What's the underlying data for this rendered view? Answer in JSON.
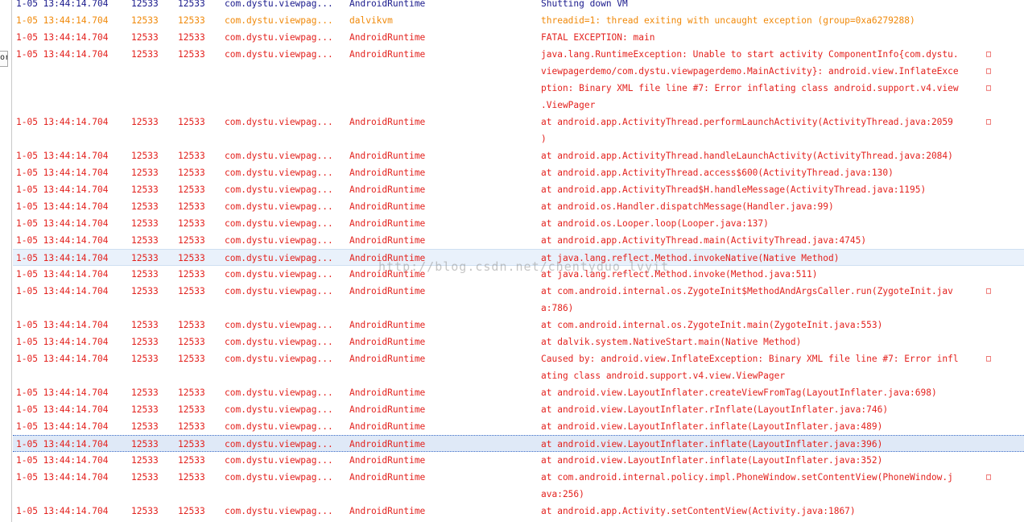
{
  "left_strip": {
    "tab_glyph": "or"
  },
  "watermark": "http://blog.csdn.net/chentyduo_lvyit",
  "wrap_marker": "□",
  "colors": {
    "info": "#1a1a8c",
    "warn": "#f0890a",
    "error": "#e3221e",
    "selected_border": "#3e6ec8"
  },
  "logs": [
    {
      "level": "info",
      "time": "1-05 13:44:14.704",
      "pid": "12533",
      "tid": "12533",
      "app": "com.dystu.viewpag...",
      "tag": "AndroidRuntime",
      "msg": [
        "Shutting down VM"
      ]
    },
    {
      "level": "warn",
      "time": "1-05 13:44:14.704",
      "pid": "12533",
      "tid": "12533",
      "app": "com.dystu.viewpag...",
      "tag": "dalvikvm",
      "msg": [
        "threadid=1: thread exiting with uncaught exception (group=0xa6279288)"
      ]
    },
    {
      "level": "error",
      "time": "1-05 13:44:14.704",
      "pid": "12533",
      "tid": "12533",
      "app": "com.dystu.viewpag...",
      "tag": "AndroidRuntime",
      "msg": [
        "FATAL EXCEPTION: main"
      ]
    },
    {
      "level": "error",
      "time": "1-05 13:44:14.704",
      "pid": "12533",
      "tid": "12533",
      "app": "com.dystu.viewpag...",
      "tag": "AndroidRuntime",
      "msg": [
        "java.lang.RuntimeException: Unable to start activity ComponentInfo{com.dystu.",
        "viewpagerdemo/com.dystu.viewpagerdemo.MainActivity}: android.view.InflateExce",
        "ption: Binary XML file line #7: Error inflating class android.support.v4.view",
        ".ViewPager"
      ]
    },
    {
      "level": "error",
      "time": "1-05 13:44:14.704",
      "pid": "12533",
      "tid": "12533",
      "app": "com.dystu.viewpag...",
      "tag": "AndroidRuntime",
      "msg": [
        "at android.app.ActivityThread.performLaunchActivity(ActivityThread.java:2059",
        ")"
      ]
    },
    {
      "level": "error",
      "time": "1-05 13:44:14.704",
      "pid": "12533",
      "tid": "12533",
      "app": "com.dystu.viewpag...",
      "tag": "AndroidRuntime",
      "msg": [
        "at android.app.ActivityThread.handleLaunchActivity(ActivityThread.java:2084)"
      ]
    },
    {
      "level": "error",
      "time": "1-05 13:44:14.704",
      "pid": "12533",
      "tid": "12533",
      "app": "com.dystu.viewpag...",
      "tag": "AndroidRuntime",
      "msg": [
        "at android.app.ActivityThread.access$600(ActivityThread.java:130)"
      ]
    },
    {
      "level": "error",
      "time": "1-05 13:44:14.704",
      "pid": "12533",
      "tid": "12533",
      "app": "com.dystu.viewpag...",
      "tag": "AndroidRuntime",
      "msg": [
        "at android.app.ActivityThread$H.handleMessage(ActivityThread.java:1195)"
      ]
    },
    {
      "level": "error",
      "time": "1-05 13:44:14.704",
      "pid": "12533",
      "tid": "12533",
      "app": "com.dystu.viewpag...",
      "tag": "AndroidRuntime",
      "msg": [
        "at android.os.Handler.dispatchMessage(Handler.java:99)"
      ]
    },
    {
      "level": "error",
      "time": "1-05 13:44:14.704",
      "pid": "12533",
      "tid": "12533",
      "app": "com.dystu.viewpag...",
      "tag": "AndroidRuntime",
      "msg": [
        "at android.os.Looper.loop(Looper.java:137)"
      ]
    },
    {
      "level": "error",
      "time": "1-05 13:44:14.704",
      "pid": "12533",
      "tid": "12533",
      "app": "com.dystu.viewpag...",
      "tag": "AndroidRuntime",
      "msg": [
        "at android.app.ActivityThread.main(ActivityThread.java:4745)"
      ]
    },
    {
      "level": "error",
      "highlight": true,
      "time": "1-05 13:44:14.704",
      "pid": "12533",
      "tid": "12533",
      "app": "com.dystu.viewpag...",
      "tag": "AndroidRuntime",
      "msg": [
        "at java.lang.reflect.Method.invokeNative(Native Method)"
      ]
    },
    {
      "level": "error",
      "time": "1-05 13:44:14.704",
      "pid": "12533",
      "tid": "12533",
      "app": "com.dystu.viewpag...",
      "tag": "AndroidRuntime",
      "msg": [
        "at java.lang.reflect.Method.invoke(Method.java:511)"
      ]
    },
    {
      "level": "error",
      "time": "1-05 13:44:14.704",
      "pid": "12533",
      "tid": "12533",
      "app": "com.dystu.viewpag...",
      "tag": "AndroidRuntime",
      "msg": [
        "at com.android.internal.os.ZygoteInit$MethodAndArgsCaller.run(ZygoteInit.jav",
        "a:786)"
      ]
    },
    {
      "level": "error",
      "time": "1-05 13:44:14.704",
      "pid": "12533",
      "tid": "12533",
      "app": "com.dystu.viewpag...",
      "tag": "AndroidRuntime",
      "msg": [
        "at com.android.internal.os.ZygoteInit.main(ZygoteInit.java:553)"
      ]
    },
    {
      "level": "error",
      "time": "1-05 13:44:14.704",
      "pid": "12533",
      "tid": "12533",
      "app": "com.dystu.viewpag...",
      "tag": "AndroidRuntime",
      "msg": [
        "at dalvik.system.NativeStart.main(Native Method)"
      ]
    },
    {
      "level": "error",
      "time": "1-05 13:44:14.704",
      "pid": "12533",
      "tid": "12533",
      "app": "com.dystu.viewpag...",
      "tag": "AndroidRuntime",
      "msg": [
        "Caused by: android.view.InflateException: Binary XML file line #7: Error infl",
        "ating class android.support.v4.view.ViewPager"
      ]
    },
    {
      "level": "error",
      "time": "1-05 13:44:14.704",
      "pid": "12533",
      "tid": "12533",
      "app": "com.dystu.viewpag...",
      "tag": "AndroidRuntime",
      "msg": [
        "at android.view.LayoutInflater.createViewFromTag(LayoutInflater.java:698)"
      ]
    },
    {
      "level": "error",
      "time": "1-05 13:44:14.704",
      "pid": "12533",
      "tid": "12533",
      "app": "com.dystu.viewpag...",
      "tag": "AndroidRuntime",
      "msg": [
        "at android.view.LayoutInflater.rInflate(LayoutInflater.java:746)"
      ]
    },
    {
      "level": "error",
      "time": "1-05 13:44:14.704",
      "pid": "12533",
      "tid": "12533",
      "app": "com.dystu.viewpag...",
      "tag": "AndroidRuntime",
      "msg": [
        "at android.view.LayoutInflater.inflate(LayoutInflater.java:489)"
      ]
    },
    {
      "level": "error",
      "selected": true,
      "time": "1-05 13:44:14.704",
      "pid": "12533",
      "tid": "12533",
      "app": "com.dystu.viewpag...",
      "tag": "AndroidRuntime",
      "msg": [
        "at android.view.LayoutInflater.inflate(LayoutInflater.java:396)"
      ]
    },
    {
      "level": "error",
      "time": "1-05 13:44:14.704",
      "pid": "12533",
      "tid": "12533",
      "app": "com.dystu.viewpag...",
      "tag": "AndroidRuntime",
      "msg": [
        "at android.view.LayoutInflater.inflate(LayoutInflater.java:352)"
      ]
    },
    {
      "level": "error",
      "time": "1-05 13:44:14.704",
      "pid": "12533",
      "tid": "12533",
      "app": "com.dystu.viewpag...",
      "tag": "AndroidRuntime",
      "msg": [
        "at com.android.internal.policy.impl.PhoneWindow.setContentView(PhoneWindow.j",
        "ava:256)"
      ]
    },
    {
      "level": "error",
      "time": "1-05 13:44:14.704",
      "pid": "12533",
      "tid": "12533",
      "app": "com.dystu.viewpag...",
      "tag": "AndroidRuntime",
      "msg": [
        "at android.app.Activity.setContentView(Activity.java:1867)"
      ]
    }
  ]
}
